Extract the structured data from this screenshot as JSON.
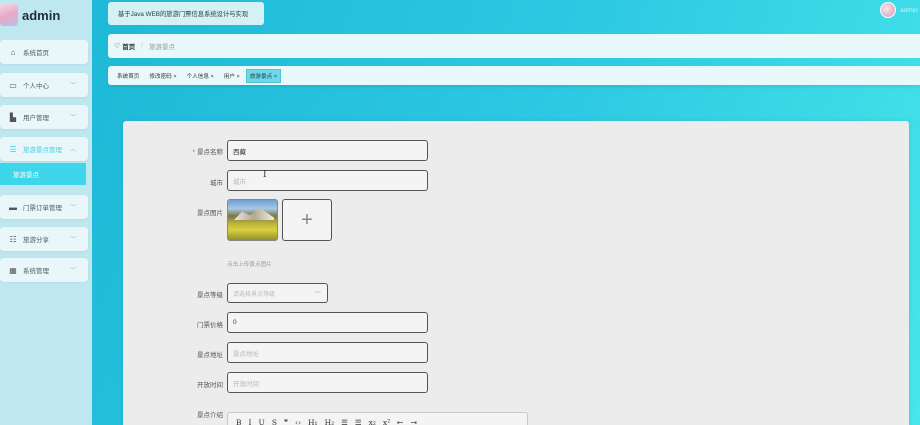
{
  "sidebar": {
    "brand": "admin",
    "items": [
      {
        "icon": "home-icon",
        "glyph": "⌂",
        "label": "系统首页"
      },
      {
        "icon": "profile-icon",
        "glyph": "▭",
        "label": "个人中心"
      },
      {
        "icon": "user-icon",
        "glyph": "▙",
        "label": "用户管理"
      },
      {
        "icon": "list-icon",
        "glyph": "☰",
        "label": "旅游景点管理"
      },
      {
        "icon": "ticket-icon",
        "glyph": "▬",
        "label": "门票订单管理"
      },
      {
        "icon": "share-icon",
        "glyph": "☷",
        "label": "旅游分享"
      },
      {
        "icon": "grid-icon",
        "glyph": "▦",
        "label": "系统管理"
      }
    ],
    "submenu_active": "旅游景点"
  },
  "header": {
    "system_title": "基于Java WEB的旅游门票信息系统设计与实现",
    "user_name": "admin"
  },
  "breadcrumb": {
    "home": "首页",
    "current": "旅游景点"
  },
  "tags": [
    "系统首页 ",
    "修改密码 ×",
    "个人信息 ×",
    "用户 ×",
    "旅游景点 ×"
  ],
  "form": {
    "name_label": "景点名称",
    "name_value": "西藏",
    "city_label": "城市",
    "city_placeholder": "城市",
    "image_label": "景点图片",
    "upload_tip": "点击上传景点图片",
    "level_label": "景点等级",
    "level_placeholder": "请选择景点等级",
    "price_label": "门票价格",
    "price_value": "0",
    "address_label": "景点地址",
    "address_placeholder": "景点地址",
    "open_label": "开放时间",
    "open_placeholder": "开放时间",
    "intro_label": "景点介绍",
    "toolbar": [
      "B",
      "I",
      "U",
      "S",
      "❞",
      "‹›",
      "H₁",
      "H₂",
      "☰",
      "☰",
      "x₂",
      "x²",
      "⇤",
      "⇥"
    ]
  },
  "colors": {
    "accent": "#3ed6ea",
    "sidebar_bg": "#bfe7ef",
    "card_bg": "#ececec"
  }
}
